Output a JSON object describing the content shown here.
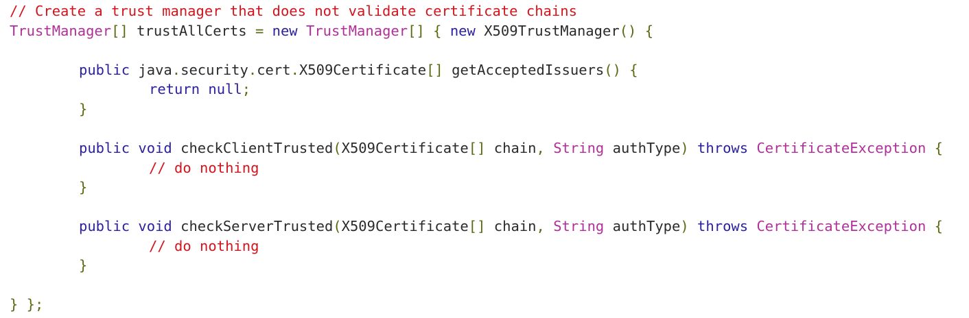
{
  "editor": {
    "lines": [
      {
        "segments": [
          {
            "t": "// Create a trust manager that does not validate certificate chains",
            "k": "comment"
          }
        ]
      },
      {
        "segments": [
          {
            "t": "TrustManager",
            "k": "type"
          },
          {
            "t": "[]",
            "k": "punc"
          },
          {
            "t": " trustAllCerts ",
            "k": "plain"
          },
          {
            "t": "=",
            "k": "punc"
          },
          {
            "t": " ",
            "k": "plain"
          },
          {
            "t": "new",
            "k": "kw"
          },
          {
            "t": " ",
            "k": "plain"
          },
          {
            "t": "TrustManager",
            "k": "type"
          },
          {
            "t": "[] {",
            "k": "punc"
          },
          {
            "t": " ",
            "k": "plain"
          },
          {
            "t": "new",
            "k": "kw"
          },
          {
            "t": " X509TrustManager",
            "k": "plain"
          },
          {
            "t": "() {",
            "k": "punc"
          }
        ]
      },
      {
        "segments": [
          {
            "t": "public",
            "k": "kw"
          },
          {
            "t": " java",
            "k": "plain"
          },
          {
            "t": ".",
            "k": "punc"
          },
          {
            "t": "security",
            "k": "plain"
          },
          {
            "t": ".",
            "k": "punc"
          },
          {
            "t": "cert",
            "k": "plain"
          },
          {
            "t": ".",
            "k": "punc"
          },
          {
            "t": "X509Certificate",
            "k": "plain"
          },
          {
            "t": "[]",
            "k": "punc"
          },
          {
            "t": " getAcceptedIssuers",
            "k": "plain"
          },
          {
            "t": "() {",
            "k": "punc"
          }
        ]
      },
      {
        "segments": [
          {
            "t": "return",
            "k": "kw"
          },
          {
            "t": " ",
            "k": "plain"
          },
          {
            "t": "null",
            "k": "kw"
          },
          {
            "t": ";",
            "k": "punc"
          }
        ]
      },
      {
        "segments": [
          {
            "t": "}",
            "k": "punc"
          }
        ]
      },
      {
        "segments": [
          {
            "t": "public",
            "k": "kw"
          },
          {
            "t": " ",
            "k": "plain"
          },
          {
            "t": "void",
            "k": "kw"
          },
          {
            "t": " checkClientTrusted",
            "k": "plain"
          },
          {
            "t": "(",
            "k": "punc"
          },
          {
            "t": "X509Certificate",
            "k": "plain"
          },
          {
            "t": "[]",
            "k": "punc"
          },
          {
            "t": " chain",
            "k": "plain"
          },
          {
            "t": ",",
            "k": "punc"
          },
          {
            "t": " ",
            "k": "plain"
          },
          {
            "t": "String",
            "k": "type"
          },
          {
            "t": " authType",
            "k": "plain"
          },
          {
            "t": ")",
            "k": "punc"
          },
          {
            "t": " ",
            "k": "plain"
          },
          {
            "t": "throws",
            "k": "kw"
          },
          {
            "t": " ",
            "k": "plain"
          },
          {
            "t": "CertificateException",
            "k": "type"
          },
          {
            "t": " {",
            "k": "punc"
          }
        ]
      },
      {
        "segments": [
          {
            "t": "// do nothing",
            "k": "comment"
          }
        ]
      },
      {
        "segments": [
          {
            "t": "}",
            "k": "punc"
          }
        ]
      },
      {
        "segments": [
          {
            "t": "public",
            "k": "kw"
          },
          {
            "t": " ",
            "k": "plain"
          },
          {
            "t": "void",
            "k": "kw"
          },
          {
            "t": " checkServerTrusted",
            "k": "plain"
          },
          {
            "t": "(",
            "k": "punc"
          },
          {
            "t": "X509Certificate",
            "k": "plain"
          },
          {
            "t": "[]",
            "k": "punc"
          },
          {
            "t": " chain",
            "k": "plain"
          },
          {
            "t": ",",
            "k": "punc"
          },
          {
            "t": " ",
            "k": "plain"
          },
          {
            "t": "String",
            "k": "type"
          },
          {
            "t": " authType",
            "k": "plain"
          },
          {
            "t": ")",
            "k": "punc"
          },
          {
            "t": " ",
            "k": "plain"
          },
          {
            "t": "throws",
            "k": "kw"
          },
          {
            "t": " ",
            "k": "plain"
          },
          {
            "t": "CertificateException",
            "k": "type"
          },
          {
            "t": " {",
            "k": "punc"
          }
        ]
      },
      {
        "segments": [
          {
            "t": "// do nothing",
            "k": "comment"
          }
        ]
      },
      {
        "segments": [
          {
            "t": "}",
            "k": "punc"
          }
        ]
      },
      {
        "segments": [
          {
            "t": "} };",
            "k": "punc"
          }
        ]
      }
    ]
  }
}
